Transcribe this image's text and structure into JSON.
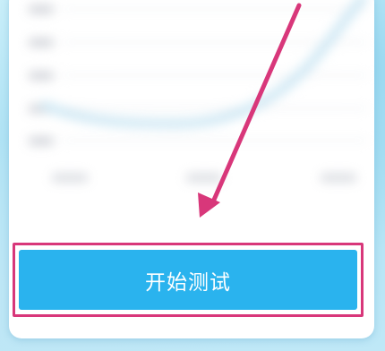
{
  "start_test_button": {
    "label": "开始测试"
  },
  "colors": {
    "button_fill": "#2ab3ee",
    "highlight_border": "#d8377a",
    "arrow": "#d8377a",
    "background": "#aee2f4"
  },
  "icons": {
    "pointer_arrow": "arrow-pointing-down-left-icon"
  },
  "chart_area": {
    "state": "blurred placeholder chart"
  }
}
